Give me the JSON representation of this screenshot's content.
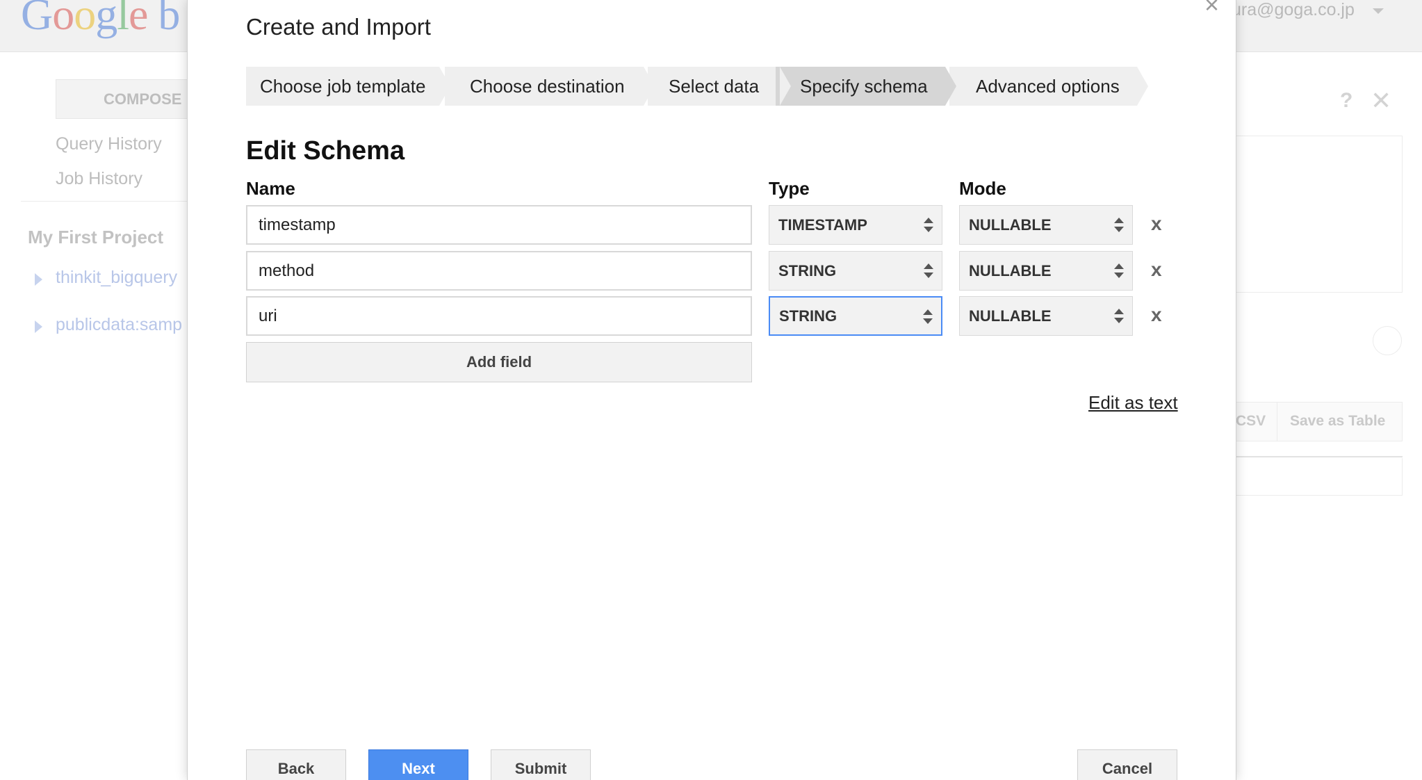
{
  "background": {
    "logo_letters": [
      "G",
      "o",
      "o",
      "g",
      "l",
      "e"
    ],
    "logo_suffix": "b",
    "user_email": "ura@goga.co.jp",
    "compose_label": "COMPOSE",
    "nav": {
      "query_history": "Query History",
      "job_history": "Job History"
    },
    "project_title": "My First Project",
    "datasets": [
      "thinkit_bigquery",
      "publicdata:samp"
    ],
    "help_icon": "?",
    "close_icon": "✕",
    "result_buttons": {
      "csv": "CSV",
      "save_as_table": "Save as Table"
    }
  },
  "dialog": {
    "title": "Create and Import",
    "close_glyph": "×",
    "steps": [
      {
        "label": "Choose job template",
        "active": false
      },
      {
        "label": "Choose destination",
        "active": false
      },
      {
        "label": "Select data",
        "active": false
      },
      {
        "label": "Specify schema",
        "active": true
      },
      {
        "label": "Advanced options",
        "active": false
      }
    ],
    "section_heading": "Edit Schema",
    "columns": {
      "name": "Name",
      "type": "Type",
      "mode": "Mode"
    },
    "fields": [
      {
        "name": "timestamp",
        "type": "TIMESTAMP",
        "mode": "NULLABLE",
        "delete": "x"
      },
      {
        "name": "method",
        "type": "STRING",
        "mode": "NULLABLE",
        "delete": "x"
      },
      {
        "name": "uri",
        "type": "STRING",
        "mode": "NULLABLE",
        "delete": "x"
      }
    ],
    "add_field_label": "Add field",
    "edit_as_text_label": "Edit as text",
    "buttons": {
      "back": "Back",
      "next": "Next",
      "submit": "Submit",
      "cancel": "Cancel"
    }
  },
  "colors": {
    "primary": "#4d8ff1",
    "focus": "#4a8bf5",
    "active_step": "#d6d6d6",
    "step": "#efefef"
  }
}
